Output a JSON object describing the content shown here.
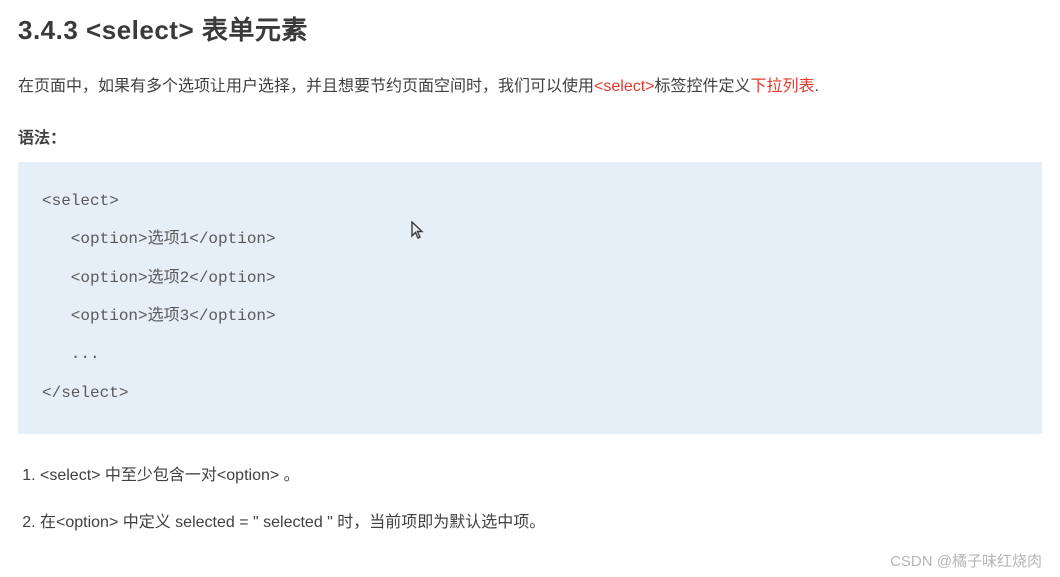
{
  "heading": "3.4.3 <select> 表单元素",
  "intro": {
    "part1": "在页面中，如果有多个选项让用户选择，并且想要节约页面空间时，我们可以使用",
    "red1": "<select>",
    "part2": "标签控件定义",
    "red2": "下拉列表",
    "part3": "."
  },
  "syntax_label": "语法：",
  "code": {
    "l1": "<select>",
    "l2": "   <option>选项1</option>",
    "l3": "   <option>选项2</option>",
    "l4": "   <option>选项3</option>",
    "l5": "   ...",
    "l6": "</select>"
  },
  "notes": {
    "n1": "<select> 中至少包含一对<option> 。",
    "n2": "在<option> 中定义 selected =  \" selected \" 时，当前项即为默认选中项。"
  },
  "watermark": "CSDN @橘子味红烧肉"
}
